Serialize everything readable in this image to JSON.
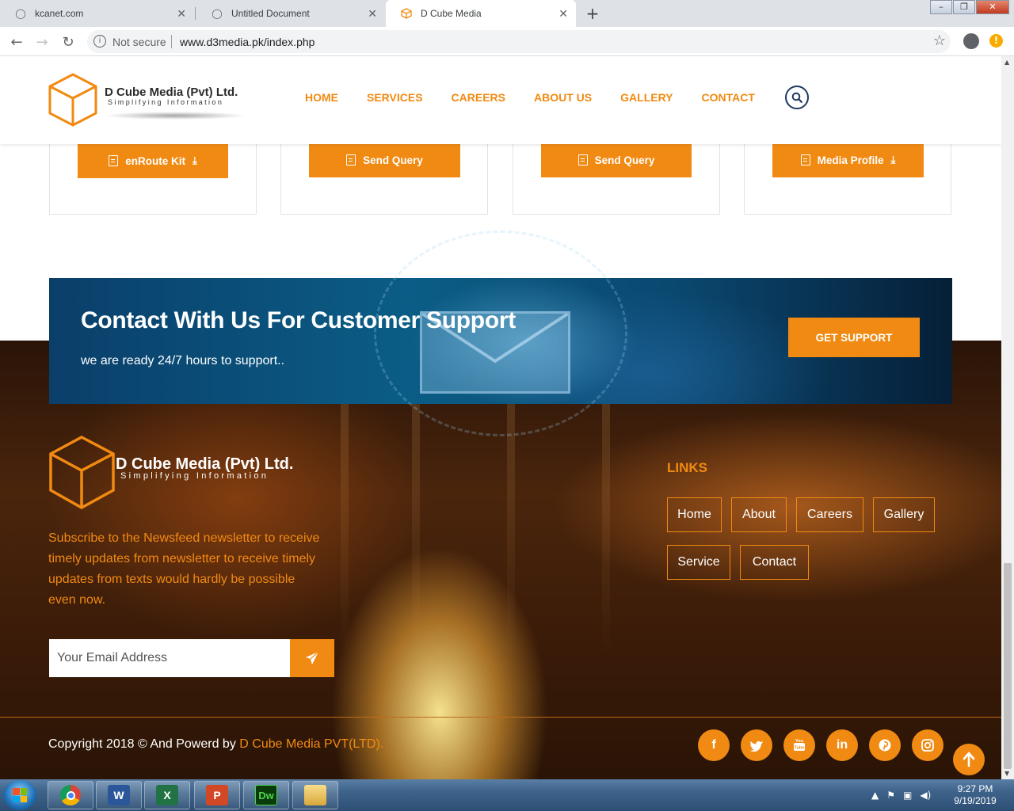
{
  "browser": {
    "tabs": [
      {
        "title": "kcanet.com",
        "active": false
      },
      {
        "title": "Untitled Document",
        "active": false
      },
      {
        "title": "D Cube Media",
        "active": true
      }
    ],
    "security": "Not secure",
    "url": "www.d3media.pk/index.php"
  },
  "header": {
    "logo_name": "D Cube Media (Pvt) Ltd.",
    "logo_tagline": "Simplifying Information",
    "nav": [
      "HOME",
      "SERVICES",
      "CAREERS",
      "ABOUT US",
      "GALLERY",
      "CONTACT"
    ]
  },
  "cards": {
    "buttons": [
      {
        "label": "enRoute Kit",
        "download": true
      },
      {
        "label": "Send Query",
        "download": false
      },
      {
        "label": "Send Query",
        "download": false
      },
      {
        "label": "Media Profile",
        "download": true
      }
    ]
  },
  "banner": {
    "title": "Contact With Us For Customer Support",
    "subtitle": "we are ready 24/7 hours to support..",
    "button": "GET SUPPORT"
  },
  "footer": {
    "logo_name": "D Cube Media (Pvt) Ltd.",
    "logo_tagline": "Simplifying Information",
    "description": "Subscribe to the Newsfeed newsletter to receive timely updates from newsletter to receive timely updates from texts would hardly be possible even now.",
    "email_placeholder": "Your Email Address",
    "links_title": "LINKS",
    "links": [
      "Home",
      "About",
      "Careers",
      "Gallery",
      "Service",
      "Contact"
    ],
    "copyright_prefix": "Copyright 2018 © And Powerd by ",
    "copyright_brand": "D Cube Media PVT(LTD).",
    "socials": [
      "facebook-icon",
      "twitter-icon",
      "youtube-icon",
      "linkedin-icon",
      "pinterest-icon",
      "instagram-icon"
    ]
  },
  "taskbar": {
    "apps": [
      "chrome",
      "word",
      "excel",
      "powerpoint",
      "dreamweaver",
      "explorer"
    ],
    "time": "9:27 PM",
    "date": "9/19/2019"
  },
  "colors": {
    "accent": "#f18a12",
    "banner_blue": "#0b5d86",
    "header_nav": "#f18a12"
  }
}
